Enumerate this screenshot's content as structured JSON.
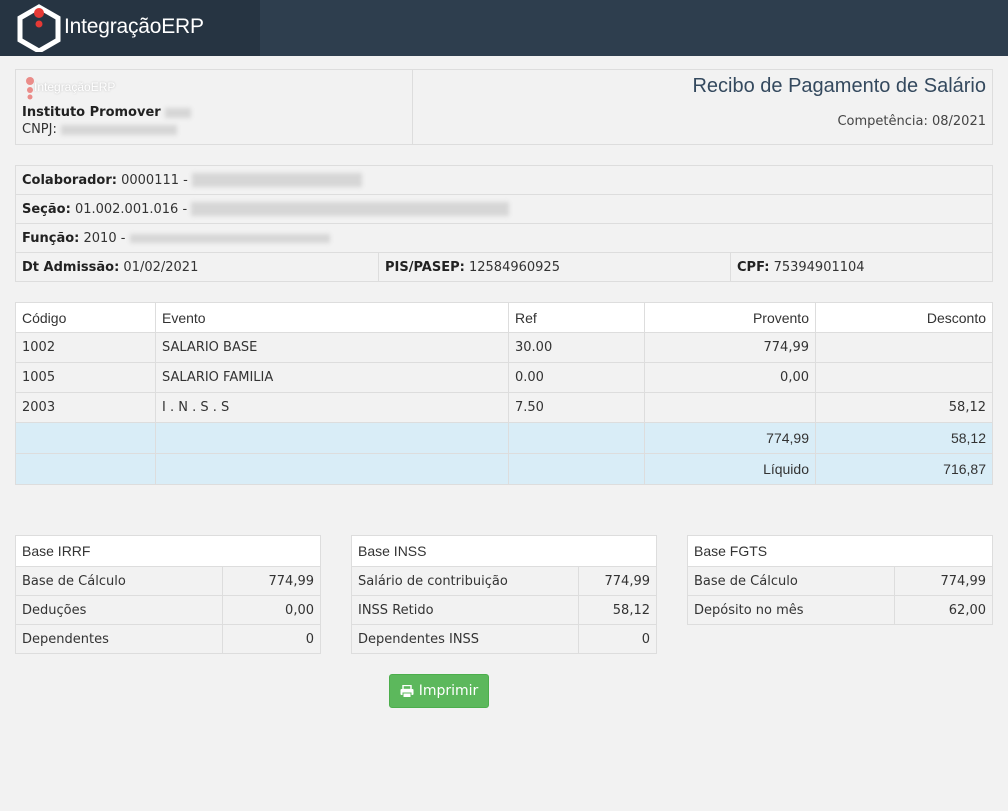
{
  "app": {
    "brand": "IntegraçãoERP",
    "mini_brand": "IntegraçãoERP"
  },
  "header": {
    "company": "Instituto Promover",
    "cnpj_label": "CNPJ:",
    "title": "Recibo de Pagamento de Salário",
    "competencia": "Competência: 08/2021"
  },
  "info": {
    "colaborador_label": "Colaborador:",
    "colaborador_value": "0000111 -",
    "secao_label": "Seção:",
    "secao_value": "01.002.001.016 -",
    "funcao_label": "Função:",
    "funcao_value": "2010 -",
    "admissao_label": "Dt Admissão:",
    "admissao_value": "01/02/2021",
    "pis_label": "PIS/PASEP:",
    "pis_value": "12584960925",
    "cpf_label": "CPF:",
    "cpf_value": "75394901104"
  },
  "events": {
    "headers": [
      "Código",
      "Evento",
      "Ref",
      "Provento",
      "Desconto"
    ],
    "rows": [
      {
        "codigo": "1002",
        "evento": "SALARIO BASE",
        "ref": "30.00",
        "provento": "774,99",
        "desconto": ""
      },
      {
        "codigo": "1005",
        "evento": "SALARIO FAMILIA",
        "ref": "0.00",
        "provento": "0,00",
        "desconto": ""
      },
      {
        "codigo": "2003",
        "evento": "I . N . S . S",
        "ref": "7.50",
        "provento": "",
        "desconto": "58,12"
      }
    ],
    "total_provento": "774,99",
    "total_desconto": "58,12",
    "liquido_label": "Líquido",
    "liquido_value": "716,87"
  },
  "bases": {
    "irrf": {
      "title": "Base IRRF",
      "rows": [
        {
          "label": "Base de Cálculo",
          "value": "774,99"
        },
        {
          "label": "Deduções",
          "value": "0,00"
        },
        {
          "label": "Dependentes",
          "value": "0"
        }
      ]
    },
    "inss": {
      "title": "Base INSS",
      "rows": [
        {
          "label": "Salário de contribuição",
          "value": "774,99"
        },
        {
          "label": "INSS Retido",
          "value": "58,12"
        },
        {
          "label": "Dependentes INSS",
          "value": "0"
        }
      ]
    },
    "fgts": {
      "title": "Base FGTS",
      "rows": [
        {
          "label": "Base de Cálculo",
          "value": "774,99"
        },
        {
          "label": "Depósito no mês",
          "value": "62,00"
        }
      ]
    }
  },
  "actions": {
    "print_label": "Imprimir"
  },
  "colors": {
    "topbar": "#2e3e4e",
    "accent_red": "#e53935",
    "total_row": "#d9edf7",
    "print_button": "#5cb85c"
  }
}
